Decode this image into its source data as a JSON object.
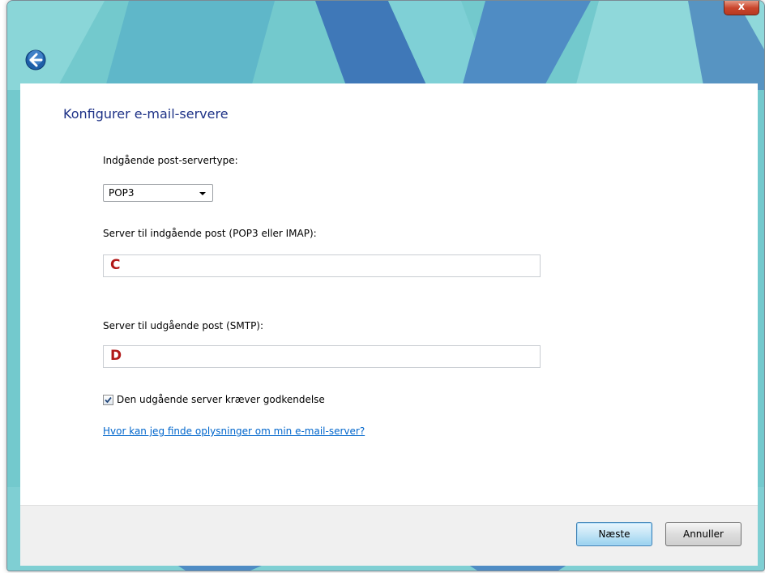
{
  "titlebar": {
    "close_label": "x",
    "back_icon": "back-arrow-icon"
  },
  "page": {
    "title": "Konfigurer e-mail-servere"
  },
  "form": {
    "incoming_type_label": "Indgående post-servertype:",
    "incoming_type_value": "POP3",
    "incoming_server_label": "Server til indgående post (POP3 eller IMAP):",
    "incoming_server_value": "C",
    "outgoing_server_label": "Server til udgående post (SMTP):",
    "outgoing_server_value": "D",
    "auth_checkbox_label": "Den udgående server kræver godkendelse",
    "auth_checkbox_checked": true,
    "help_link": "Hvor kan jeg finde oplysninger om min e-mail-server?"
  },
  "footer": {
    "next_label": "Næste",
    "cancel_label": "Annuller"
  },
  "colors": {
    "frame_teal": "#6cc6cc",
    "title_blue": "#1e3287",
    "field_text_red": "#b11818",
    "link_blue": "#0066cc",
    "close_red": "#c9452c"
  }
}
